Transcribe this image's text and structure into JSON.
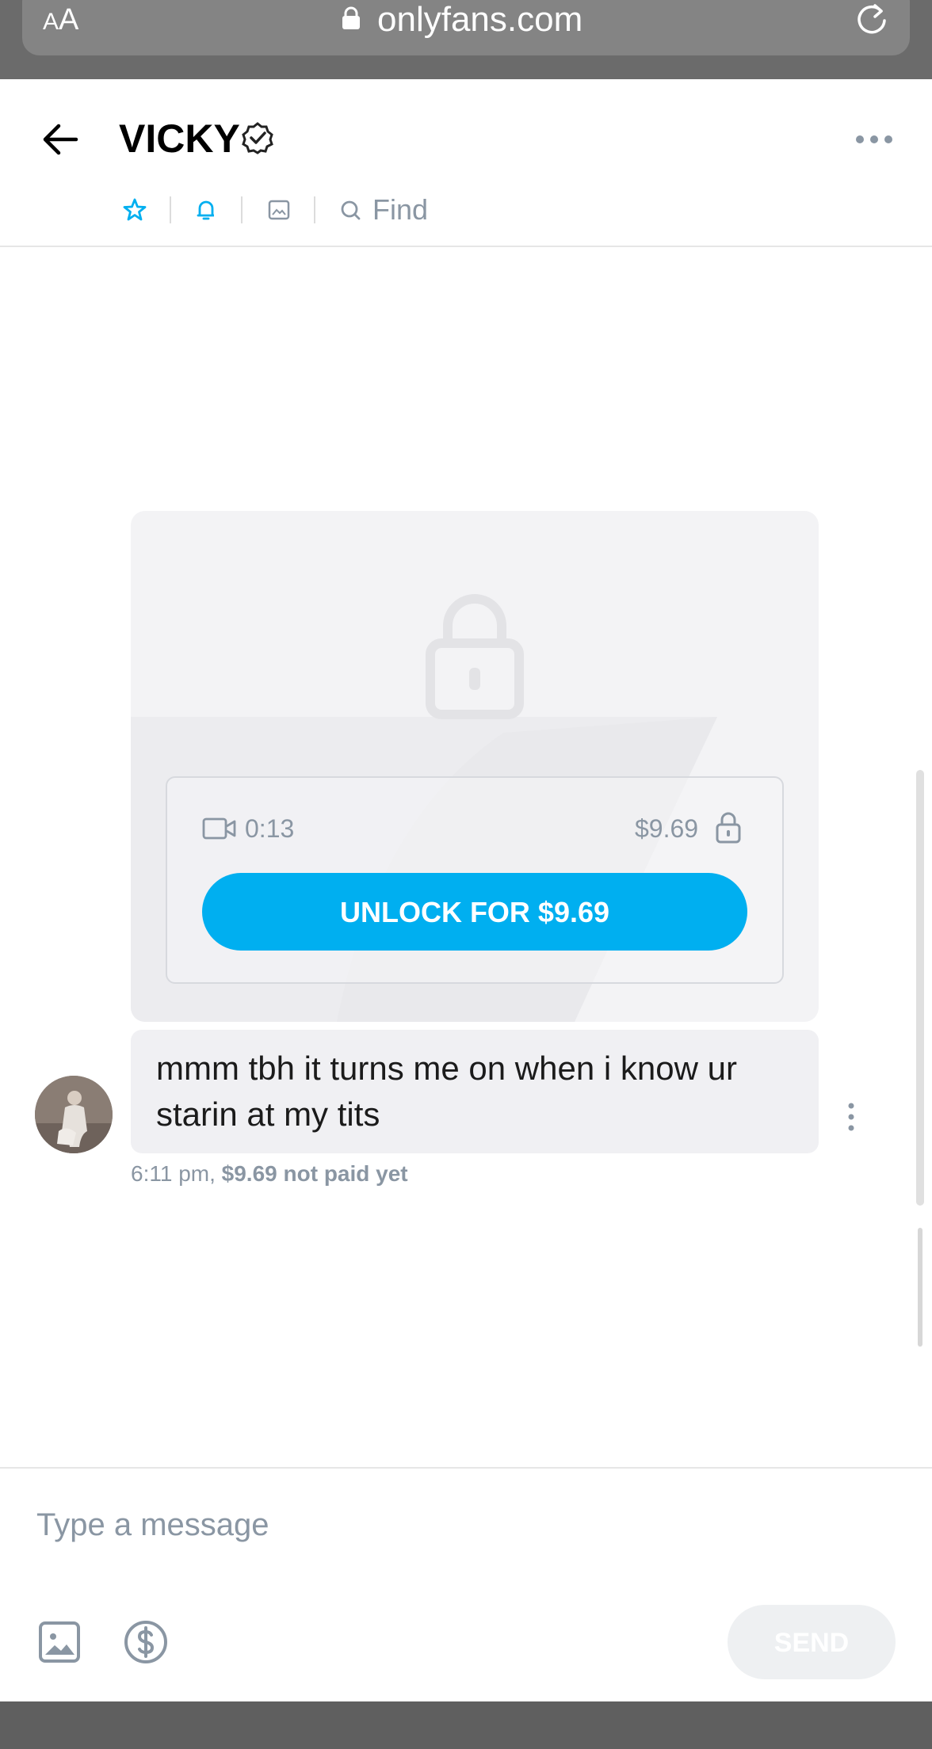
{
  "browser": {
    "text_size_label_small": "A",
    "text_size_label_large": "A",
    "url": "onlyfans.com"
  },
  "header": {
    "title": "VICKY",
    "toolbar": {
      "find_label": "Find"
    }
  },
  "media": {
    "duration": "0:13",
    "price": "$9.69",
    "unlock_label": "UNLOCK FOR $9.69"
  },
  "message": {
    "text": "mmm tbh it turns me on when i know ur starin at my tits",
    "time": "6:11 pm,",
    "payment_status": "$9.69 not paid yet"
  },
  "composer": {
    "placeholder": "Type a message",
    "send_label": "SEND"
  },
  "colors": {
    "accent": "#00aff0",
    "muted_text": "#8a96a3",
    "bubble_bg": "#f0f0f3"
  },
  "icons": [
    "lock-icon",
    "reload-icon",
    "back-arrow-icon",
    "verified-badge-icon",
    "more-dots-icon",
    "star-icon",
    "bell-icon",
    "image-icon",
    "search-icon",
    "video-camera-icon",
    "padlock-icon",
    "vertical-dots-icon",
    "dollar-coin-icon"
  ]
}
